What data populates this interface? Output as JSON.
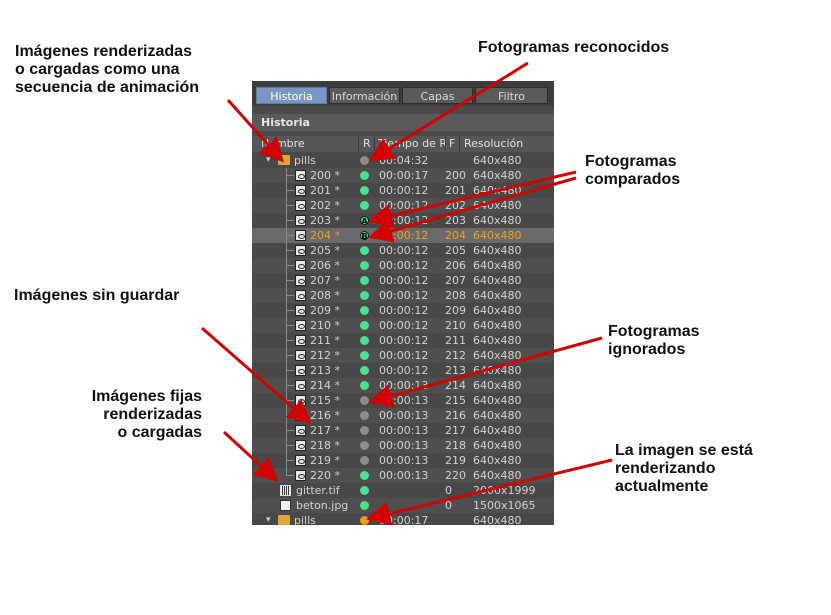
{
  "callouts": {
    "sequence": "Imágenes renderizadas\no cargadas como una\nsecuencia de animación",
    "recognized": "Fotogramas reconocidos",
    "compared": "Fotogramas\ncomparados",
    "unsaved": "Imágenes sin guardar",
    "ignored": "Fotogramas\nignorados",
    "still": "Imágenes fijas\nrenderizadas\no cargadas",
    "rendering": "La imagen se está\nrenderizando\nactualmente"
  },
  "tabs": [
    {
      "label": "Historia",
      "active": true
    },
    {
      "label": "Información",
      "active": false
    },
    {
      "label": "Capas",
      "active": false
    },
    {
      "label": "Filtro",
      "active": false
    }
  ],
  "section_title": "Historia",
  "columns": {
    "name": "Nombre",
    "r": "R",
    "time": "Tiempo de R",
    "f": "F",
    "res": "Resolución"
  },
  "colors": {
    "green": "#46e48e",
    "gray": "#8c8c8c",
    "orange": "#f29a1a",
    "arrow": "#d40000"
  },
  "rows": [
    {
      "kind": "folder",
      "name": "pills",
      "status": "gray",
      "time": "00:04:32",
      "f": "",
      "res": "640x480"
    },
    {
      "kind": "frame",
      "name": "200 *",
      "status": "green",
      "time": "00:00:17",
      "f": "200",
      "res": "640x480"
    },
    {
      "kind": "frame",
      "name": "201 *",
      "status": "green",
      "time": "00:00:12",
      "f": "201",
      "res": "640x480"
    },
    {
      "kind": "frame",
      "name": "202 *",
      "status": "green",
      "time": "00:00:12",
      "f": "202",
      "res": "640x480"
    },
    {
      "kind": "frame",
      "name": "203 *",
      "status": "green",
      "letter": "A",
      "time": "00:00:12",
      "f": "203",
      "res": "640x480"
    },
    {
      "kind": "frame",
      "name": "204 *",
      "status": "green",
      "letter": "B",
      "time": "00:00:12",
      "f": "204",
      "res": "640x480",
      "selected": true
    },
    {
      "kind": "frame",
      "name": "205 *",
      "status": "green",
      "time": "00:00:12",
      "f": "205",
      "res": "640x480"
    },
    {
      "kind": "frame",
      "name": "206 *",
      "status": "green",
      "time": "00:00:12",
      "f": "206",
      "res": "640x480"
    },
    {
      "kind": "frame",
      "name": "207 *",
      "status": "green",
      "time": "00:00:12",
      "f": "207",
      "res": "640x480"
    },
    {
      "kind": "frame",
      "name": "208 *",
      "status": "green",
      "time": "00:00:12",
      "f": "208",
      "res": "640x480"
    },
    {
      "kind": "frame",
      "name": "209 *",
      "status": "green",
      "time": "00:00:12",
      "f": "209",
      "res": "640x480"
    },
    {
      "kind": "frame",
      "name": "210 *",
      "status": "green",
      "time": "00:00:12",
      "f": "210",
      "res": "640x480"
    },
    {
      "kind": "frame",
      "name": "211 *",
      "status": "green",
      "time": "00:00:12",
      "f": "211",
      "res": "640x480"
    },
    {
      "kind": "frame",
      "name": "212 *",
      "status": "green",
      "time": "00:00:12",
      "f": "212",
      "res": "640x480"
    },
    {
      "kind": "frame",
      "name": "213 *",
      "status": "green",
      "time": "00:00:12",
      "f": "213",
      "res": "640x480"
    },
    {
      "kind": "frame",
      "name": "214 *",
      "status": "green",
      "time": "00:00:13",
      "f": "214",
      "res": "640x480"
    },
    {
      "kind": "frame",
      "name": "215 *",
      "status": "gray",
      "time": "00:00:13",
      "f": "215",
      "res": "640x480"
    },
    {
      "kind": "frame",
      "name": "216 *",
      "status": "gray",
      "time": "00:00:13",
      "f": "216",
      "res": "640x480"
    },
    {
      "kind": "frame",
      "name": "217 *",
      "status": "gray",
      "time": "00:00:13",
      "f": "217",
      "res": "640x480"
    },
    {
      "kind": "frame",
      "name": "218 *",
      "status": "gray",
      "time": "00:00:13",
      "f": "218",
      "res": "640x480"
    },
    {
      "kind": "frame",
      "name": "219 *",
      "status": "gray",
      "time": "00:00:13",
      "f": "219",
      "res": "640x480"
    },
    {
      "kind": "frame",
      "name": "220 *",
      "status": "green",
      "time": "00:00:13",
      "f": "220",
      "res": "640x480"
    },
    {
      "kind": "still-grid",
      "name": "gitter.tif",
      "status": "green",
      "time": "",
      "f": "0",
      "res": "2000x1999"
    },
    {
      "kind": "still-img",
      "name": "beton.jpg",
      "status": "green",
      "time": "",
      "f": "0",
      "res": "1500x1065"
    },
    {
      "kind": "folder",
      "name": "pills",
      "status": "orange",
      "time": "00:00:17",
      "f": "",
      "res": "640x480"
    }
  ]
}
